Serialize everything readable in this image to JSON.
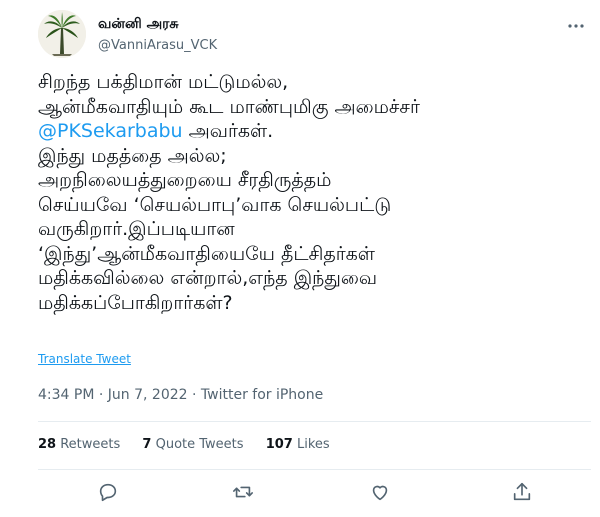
{
  "user": {
    "display_name": "வன்னி அரசு",
    "handle": "@VanniArasu_VCK"
  },
  "more_icon": "more-icon",
  "tweet": {
    "line1": "சிறந்த பக்திமான் மட்டுமல்ல,",
    "line2": "ஆன்மீகவாதியும் கூட மாண்புமிகு அமைச்சர்",
    "mention": "@PKSekarbabu",
    "line3_suffix": " அவர்கள்.",
    "line4": "இந்து மதத்தை அல்ல;",
    "line5": "அறநிலையத்துறையை சீரதிருத்தம்",
    "line6": "செய்யவே ‘செயல்பாபு’வாக செயல்பட்டு",
    "line7": "வருகிறார்.இப்படியான",
    "line8": "‘இந்து’ஆன்மீகவாதியையே தீட்சிதர்கள்",
    "line9": "மதிக்கவில்லை என்றால்,எந்த இந்துவை",
    "line10": "மதிக்கப்போகிறார்கள்?"
  },
  "translate_label": "Translate Tweet",
  "meta": {
    "time": "4:34 PM",
    "date": "Jun 7, 2022",
    "source": "Twitter for iPhone",
    "separator": " · "
  },
  "stats": {
    "retweets_count": "28",
    "retweets_label": "Retweets",
    "quotes_count": "7",
    "quotes_label": "Quote Tweets",
    "likes_count": "107",
    "likes_label": "Likes"
  },
  "actions": [
    "reply-icon",
    "retweet-icon",
    "like-icon",
    "share-icon"
  ],
  "colors": {
    "link": "#1d9bf0",
    "muted": "#536471",
    "text": "#0f1419",
    "divider": "#e6ecf0"
  }
}
